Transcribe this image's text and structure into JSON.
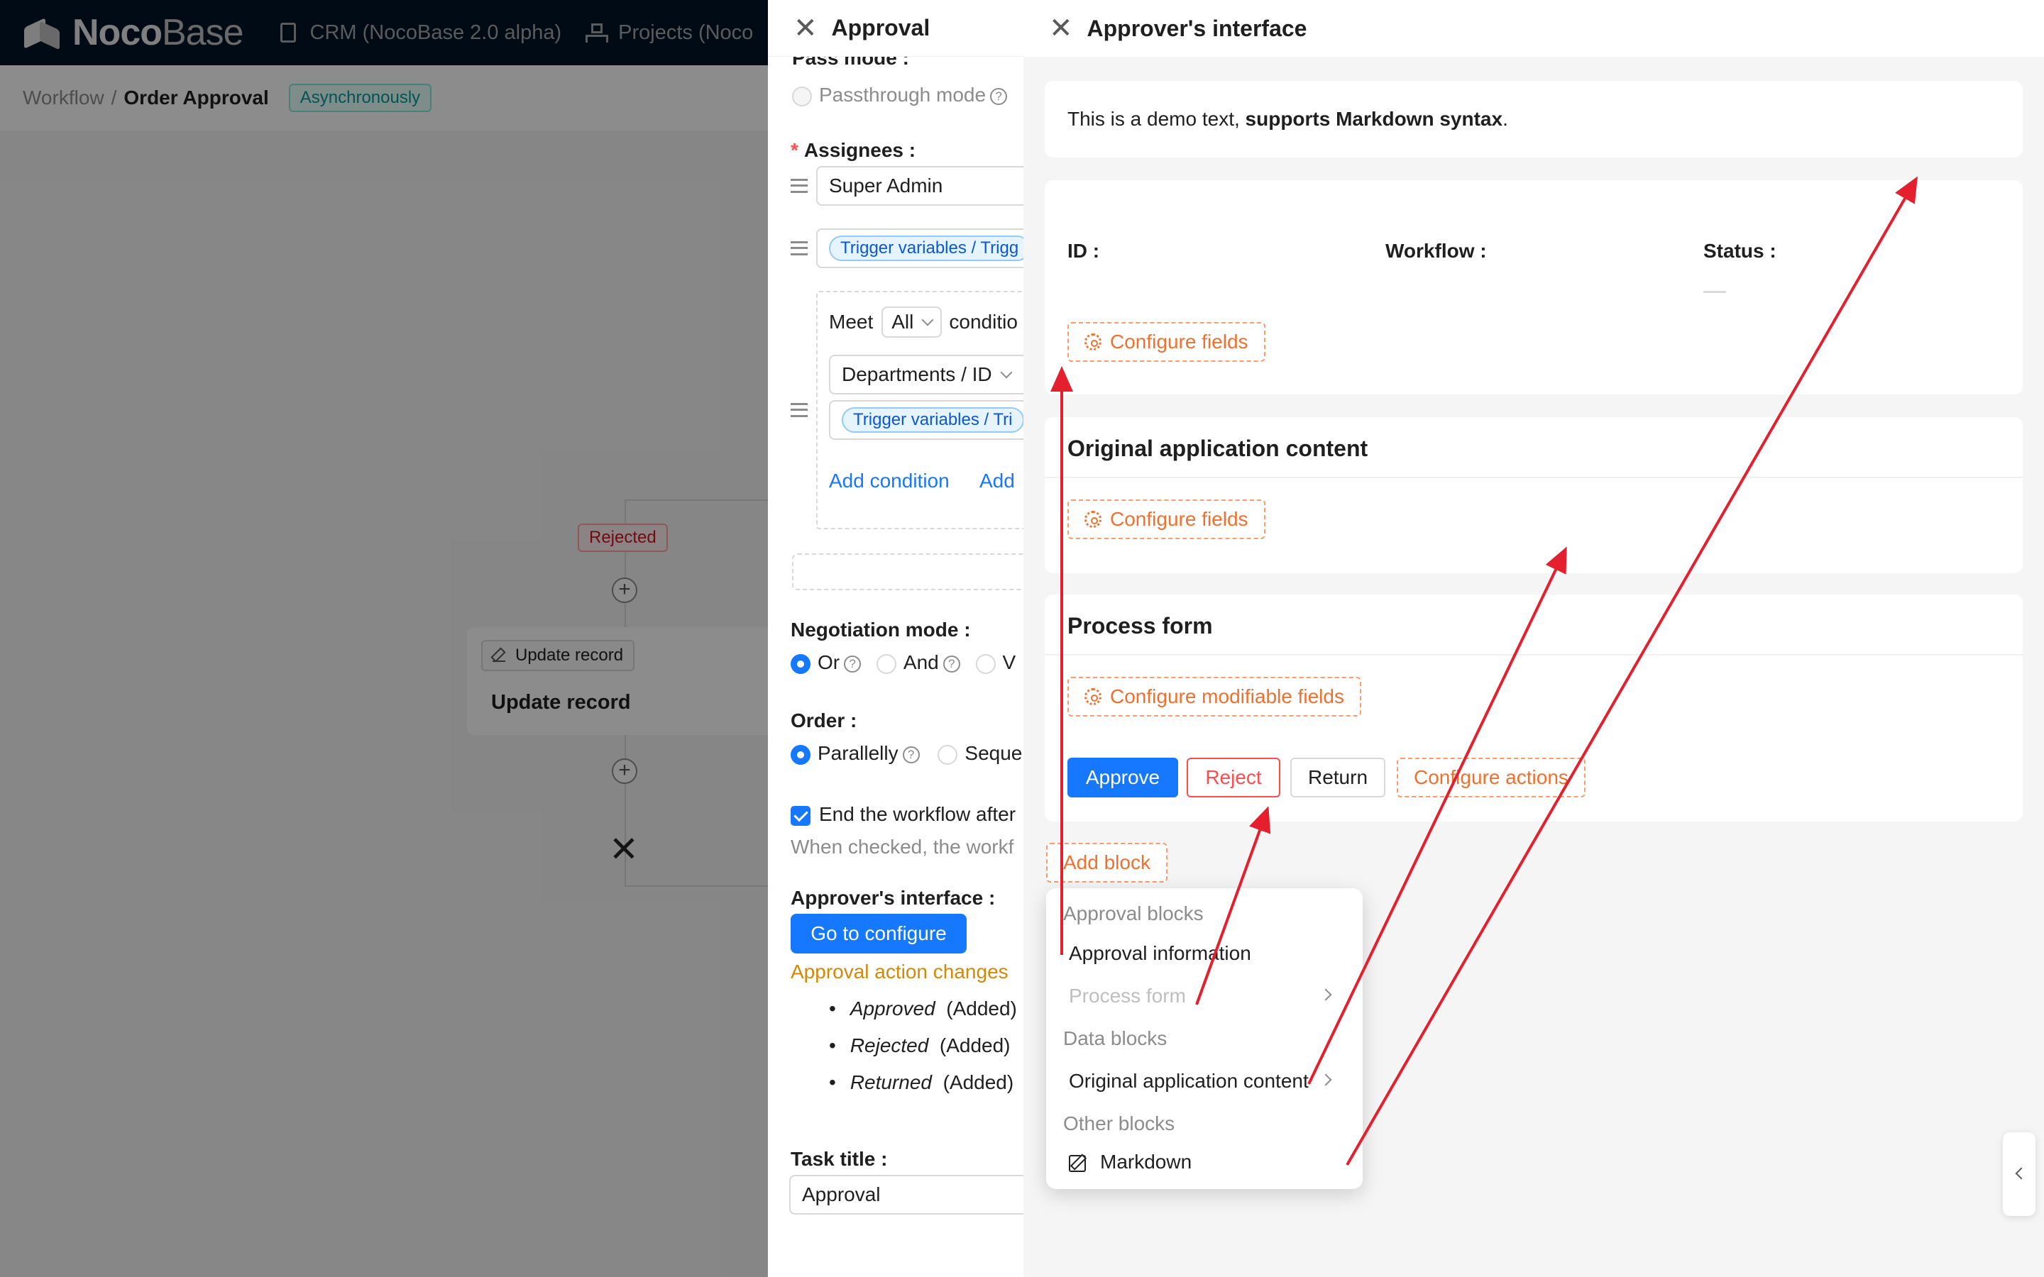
{
  "app": {
    "logo_bold": "Noco",
    "logo_light": "Base",
    "nav": [
      {
        "label": "CRM (NocoBase 2.0 alpha)",
        "icon": "book-icon"
      },
      {
        "label": "Projects (Noco",
        "icon": "org-tree-icon"
      }
    ]
  },
  "breadcrumb": {
    "parent": "Workflow",
    "separator": "/",
    "current": "Order Approval",
    "mode_tag": "Asynchronously"
  },
  "canvas": {
    "rejected_tag": "Rejected",
    "node_tag": "Update record",
    "node_title": "Update record",
    "plus": "+",
    "end": "✕"
  },
  "approval_drawer": {
    "title": "Approval",
    "pass_mode_label": "Pass mode :",
    "passthrough": "Passthrough mode",
    "assignees_label": "Assignees :",
    "assignee_1": "Super Admin",
    "assignee_2_tag": "Trigger variables / Trigg",
    "meet": "Meet",
    "meet_value": "All",
    "conditions": "conditio",
    "cond_field": "Departments / ID",
    "cond_value_tag": "Trigger variables / Tri",
    "add_condition": "Add condition",
    "add_group": "Add",
    "negotiation_label": "Negotiation mode :",
    "neg_or": "Or",
    "neg_and": "And",
    "neg_v": "V",
    "order_label": "Order :",
    "order_parallel": "Parallelly",
    "order_seq": "Seque",
    "end_workflow": "End the workflow after",
    "end_workflow_hint": "When checked, the workf",
    "approver_label": "Approver's interface :",
    "go_configure": "Go to configure",
    "action_changes": "Approval action changes",
    "changes": [
      {
        "name": "Approved",
        "status": "(Added)"
      },
      {
        "name": "Rejected",
        "status": "(Added)"
      },
      {
        "name": "Returned",
        "status": "(Added)"
      }
    ],
    "task_title_label": "Task title :",
    "task_title_value": "Approval"
  },
  "approver_drawer": {
    "title": "Approver's interface",
    "markdown_plain": "This is a demo text, ",
    "markdown_bold": "supports Markdown syntax",
    "markdown_end": ".",
    "info_fields": [
      {
        "label": "ID :"
      },
      {
        "label": "Workflow :"
      },
      {
        "label": "Status :"
      }
    ],
    "configure_fields": "Configure fields",
    "original_title": "Original application content",
    "process_title": "Process form",
    "configure_modifiable": "Configure modifiable fields",
    "actions": {
      "approve": "Approve",
      "reject": "Reject",
      "return": "Return",
      "configure_actions": "Configure actions"
    },
    "add_block": "Add block",
    "menu": {
      "group_approval": "Approval blocks",
      "approval_information": "Approval information",
      "process_form": "Process form",
      "group_data": "Data blocks",
      "original_content": "Original application content",
      "group_other": "Other blocks",
      "markdown": "Markdown"
    }
  },
  "colors": {
    "primary": "#1677ff",
    "dashed_orange": "#f2702e",
    "danger": "#ff4d4f",
    "annotation_red": "#e5202e",
    "header_dark": "#001529"
  }
}
